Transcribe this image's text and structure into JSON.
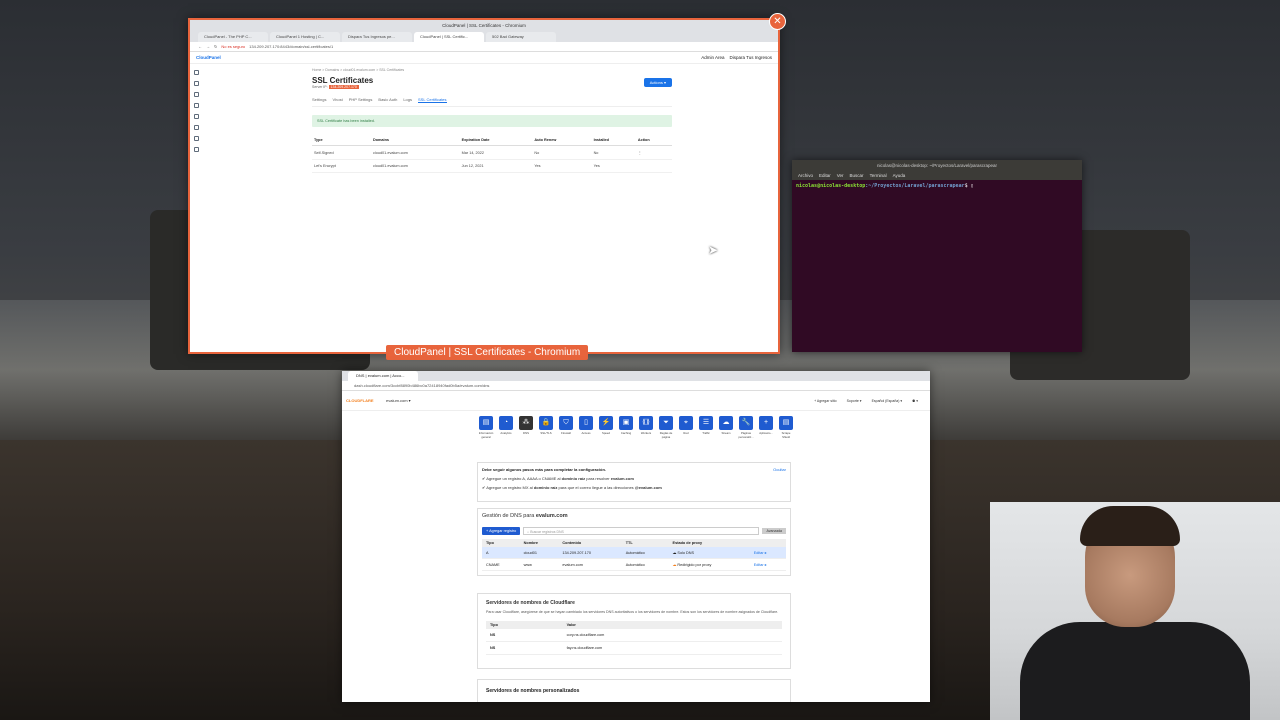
{
  "top_window": {
    "title": "CloudPanel | SSL Certificates - Chromium",
    "label": "CloudPanel | SSL Certificates - Chromium",
    "tabs": [
      "CloudPanel - The PHP C...",
      "CloudPanel 1 Hosting | C...",
      "Dispara Tus Ingresos pe...",
      "CloudPanel | SSL Certific...",
      "502 Bad Gateway"
    ],
    "url_insecure": "No es seguro",
    "url": "134.209.207.170:8443/domain/ssl-certificates/1",
    "app_name": "CloudPanel",
    "user": "Admin Area",
    "user_menu": "Dispara Tus Ingresos",
    "breadcrumb": "Home  >  Domains  >  cloud01.evalum.com  >  SSL Certificates",
    "page_title": "SSL Certificates",
    "server_ip_label": "Server IP:",
    "server_ip": "134.209.207.170",
    "actions_label": "Actions ▾",
    "subtabs": [
      "Settings",
      "Vhost",
      "PHP Settings",
      "Basic Auth",
      "Logs",
      "SSL Certificates"
    ],
    "alert": "SSL Certificate has been installed.",
    "table_headers": [
      "Type",
      "Domains",
      "Expiration Date",
      "Auto Renew",
      "Installed",
      "Action"
    ],
    "rows": [
      [
        "Self-Signed",
        "cloud01.evalum.com",
        "Mar 14, 2022",
        "No",
        "No",
        "⋮"
      ],
      [
        "Let's Encrypt",
        "cloud01.evalum.com",
        "Jun 12, 2021",
        "Yes",
        "Yes",
        ""
      ]
    ]
  },
  "terminal": {
    "title": "nicolas@nicolas-desktop: ~/Proyectos/Laravel/parascrapear",
    "menu": [
      "Archivo",
      "Editar",
      "Ver",
      "Buscar",
      "Terminal",
      "Ayuda"
    ],
    "user": "nicolas@nicolas-desktop",
    "path": ":~/Proyectos/Laravel/parascrapear",
    "prompt_end": "$ "
  },
  "cf_window": {
    "tab": "DNS | evalum.com | Acco...",
    "url": "dash.cloudflare.com/3ccbf8890b486bc0a72418940fad0b5a/evalum.com/dns",
    "logo": "CLOUDFLARE",
    "domain": "evalum.com ▾",
    "right_items": [
      "+ Agregar sitio",
      "Soporte ▾",
      "Español (España) ▾",
      "⚉ ▾"
    ],
    "icons": [
      {
        "label": "Información general",
        "glyph": "▤"
      },
      {
        "label": "Analytics",
        "glyph": "◔"
      },
      {
        "label": "DNS",
        "glyph": "⁂"
      },
      {
        "label": "SSL/TLS",
        "glyph": "🔒"
      },
      {
        "label": "Firewall",
        "glyph": "⛉"
      },
      {
        "label": "Access",
        "glyph": "▯"
      },
      {
        "label": "Speed",
        "glyph": "⚡"
      },
      {
        "label": "Caching",
        "glyph": "▣"
      },
      {
        "label": "Workers",
        "glyph": "⟪⟫"
      },
      {
        "label": "Reglas de página",
        "glyph": "⏷"
      },
      {
        "label": "Red",
        "glyph": "⌖"
      },
      {
        "label": "Traffic",
        "glyph": "☰"
      },
      {
        "label": "Stream",
        "glyph": "☁"
      },
      {
        "label": "Páginas personaliz...",
        "glyph": "🔧"
      },
      {
        "label": "Aplicacio...",
        "glyph": "+"
      },
      {
        "label": "Scrape Shield",
        "glyph": "▤"
      }
    ],
    "steps_title": "Debe seguir algunos pasos más para completar la configuración.",
    "steps_hide": "Ocultar",
    "step1_pre": "Agregue un registro A, AAAA o CNAME al ",
    "step1_bold": "dominio raíz",
    "step1_mid": " para resolver ",
    "step1_domain": "evalum.com",
    "step2_pre": "Agregue un registro MX al ",
    "step2_bold": "dominio raíz",
    "step2_mid": " para que el correo llegue a las direcciones ",
    "step2_domain": "@evalum.com",
    "dns_title_pre": "Gestión de DNS para ",
    "dns_title_domain": "evalum.com",
    "add_record": "+ Agregar registro",
    "search_placeholder": "Buscar registros DNS",
    "advanced": "Avanzada",
    "dns_headers": [
      "Tipo",
      "Nombre",
      "Contenido",
      "TTL",
      "Estado de proxy",
      ""
    ],
    "dns_rows": [
      [
        "A",
        "cloud01",
        "134.209.207.170",
        "Automático",
        "Solo DNS",
        "Editar ▸"
      ],
      [
        "CNAME",
        "www",
        "evalum.com",
        "Automático",
        "Redirigido por proxy",
        "Editar ▸"
      ]
    ],
    "ns_title": "Servidores de nombres de Cloudflare",
    "ns_desc": "Para usar Cloudflare, asegúrese de que se hayan cambiado los servidores DNS autoritativos o los servidores de nombre. Estos son los servidores de nombre asignados de Cloudflare.",
    "ns_headers": [
      "Tipo",
      "Valor"
    ],
    "ns_rows": [
      [
        "NS",
        "cory.ns.cloudflare.com"
      ],
      [
        "NS",
        "fay.ns.cloudflare.com"
      ]
    ],
    "custom_ns_title": "Servidores de nombres personalizados"
  },
  "colors": {
    "accent": "#e8643c",
    "cf_blue": "#1f5bd0",
    "terminal_bg": "#300a24"
  }
}
